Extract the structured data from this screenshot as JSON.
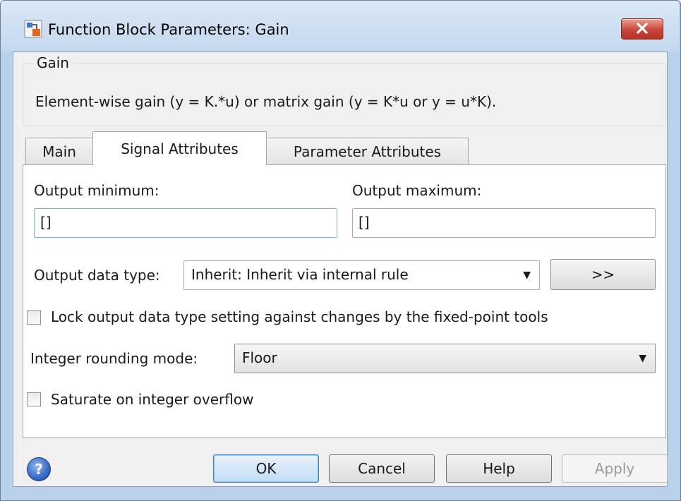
{
  "window": {
    "title": "Function Block Parameters: Gain"
  },
  "group": {
    "legend": "Gain",
    "description": "Element-wise gain (y = K.*u) or matrix gain (y = K*u or y = u*K)."
  },
  "tabs": [
    {
      "label": "Main",
      "active": false
    },
    {
      "label": "Signal Attributes",
      "active": true
    },
    {
      "label": "Parameter Attributes",
      "active": false
    }
  ],
  "signal_attributes": {
    "output_minimum_label": "Output minimum:",
    "output_minimum_value": "[]",
    "output_maximum_label": "Output maximum:",
    "output_maximum_value": "[]",
    "output_data_type_label": "Output data type:",
    "output_data_type_value": "Inherit: Inherit via internal rule",
    "data_type_assistant_label": ">>",
    "lock_label": "Lock output data type setting against changes by the fixed-point tools",
    "lock_checked": false,
    "rounding_label": "Integer rounding mode:",
    "rounding_value": "Floor",
    "saturate_label": "Saturate on integer overflow",
    "saturate_checked": false
  },
  "buttons": {
    "ok": "OK",
    "cancel": "Cancel",
    "help": "Help",
    "apply": "Apply",
    "help_icon_glyph": "?"
  },
  "colors": {
    "title_bar": "#c4d8ee",
    "close_button": "#c7473a",
    "ok_button_focus": "#3c7fb1",
    "help_icon": "#2a5fbe"
  },
  "icons": [
    "app-block-icon",
    "close-icon",
    "dropdown-arrow-icon",
    "help-icon"
  ]
}
